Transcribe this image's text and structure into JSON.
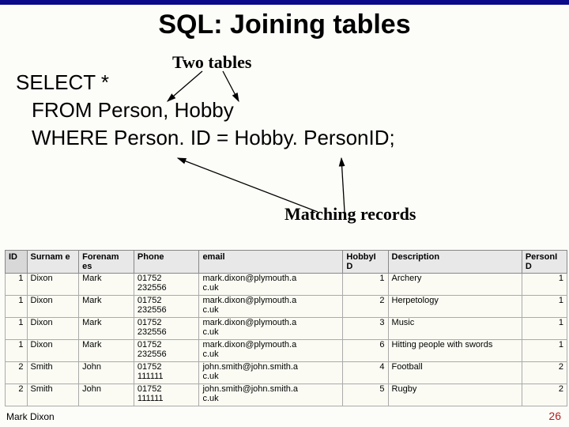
{
  "title": "SQL: Joining tables",
  "annot": {
    "two_tables": "Two tables",
    "matching": "Matching records"
  },
  "sql": {
    "line1": "SELECT *",
    "line2": "FROM Person, Hobby",
    "line3": "WHERE Person. ID = Hobby. PersonID;"
  },
  "headers": {
    "id": "ID",
    "surname": "Surnam e",
    "forenames": "Forenam es",
    "phone": "Phone",
    "email": "email",
    "hobbyid": "HobbyI D",
    "desc": "Description",
    "personid": "PersonI D"
  },
  "rows": [
    {
      "id": "1",
      "sur": "Dixon",
      "for": "Mark",
      "p1": "01752",
      "p2": "232556",
      "e1": "mark.dixon@plymouth.a",
      "e2": "c.uk",
      "hid": "1",
      "desc": "Archery",
      "pid": "1"
    },
    {
      "id": "1",
      "sur": "Dixon",
      "for": "Mark",
      "p1": "01752",
      "p2": "232556",
      "e1": "mark.dixon@plymouth.a",
      "e2": "c.uk",
      "hid": "2",
      "desc": "Herpetology",
      "pid": "1"
    },
    {
      "id": "1",
      "sur": "Dixon",
      "for": "Mark",
      "p1": "01752",
      "p2": "232556",
      "e1": "mark.dixon@plymouth.a",
      "e2": "c.uk",
      "hid": "3",
      "desc": "Music",
      "pid": "1"
    },
    {
      "id": "1",
      "sur": "Dixon",
      "for": "Mark",
      "p1": "01752",
      "p2": "232556",
      "e1": "mark.dixon@plymouth.a",
      "e2": "c.uk",
      "hid": "6",
      "desc": "Hitting people with swords",
      "pid": "1"
    },
    {
      "id": "2",
      "sur": "Smith",
      "for": "John",
      "p1": "01752",
      "p2": "111111",
      "e1": "john.smith@john.smith.a",
      "e2": "c.uk",
      "hid": "4",
      "desc": "Football",
      "pid": "2"
    },
    {
      "id": "2",
      "sur": "Smith",
      "for": "John",
      "p1": "01752",
      "p2": "111111",
      "e1": "john.smith@john.smith.a",
      "e2": "c.uk",
      "hid": "5",
      "desc": "Rugby",
      "pid": "2"
    }
  ],
  "footer": {
    "left": "Mark Dixon",
    "right": "26"
  }
}
